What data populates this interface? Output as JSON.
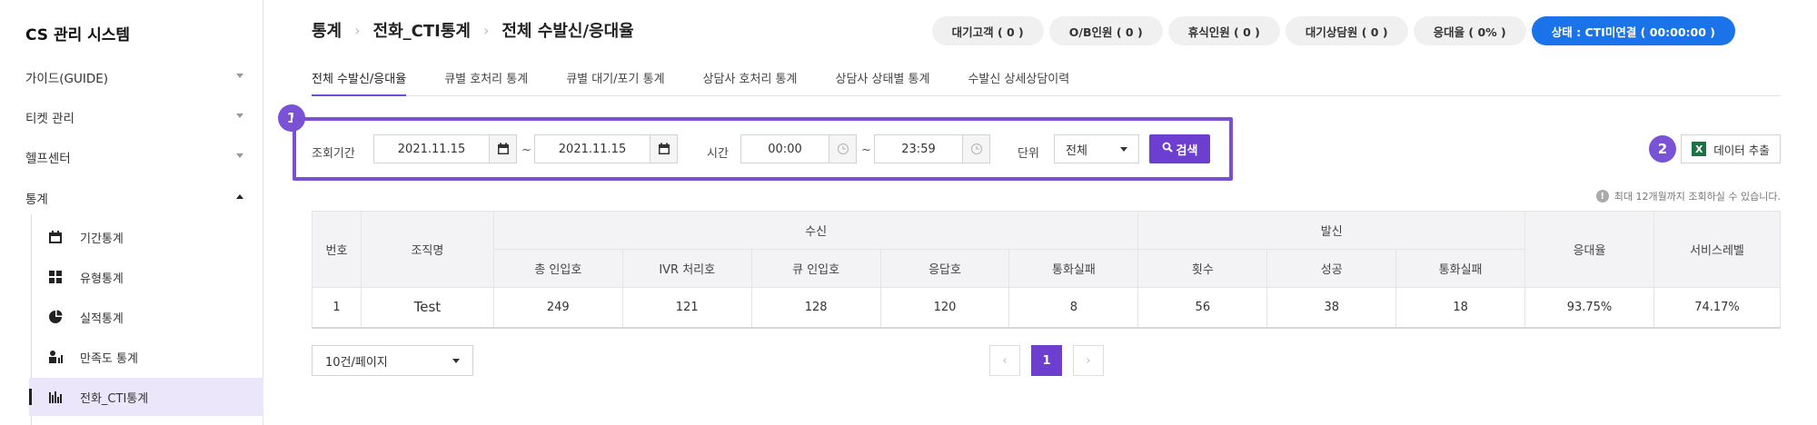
{
  "app": {
    "title": "CS 관리 시스템"
  },
  "sidebar": {
    "menus": [
      {
        "label": "가이드(GUIDE)",
        "expanded": false
      },
      {
        "label": "티켓 관리",
        "expanded": false
      },
      {
        "label": "헬프센터",
        "expanded": false
      },
      {
        "label": "통계",
        "expanded": true
      }
    ],
    "sub_items": [
      {
        "label": "기간통계",
        "icon": "calendar-icon"
      },
      {
        "label": "유형통계",
        "icon": "grid-icon"
      },
      {
        "label": "실적통계",
        "icon": "pie-chart-icon"
      },
      {
        "label": "만족도 통계",
        "icon": "satisfaction-icon"
      },
      {
        "label": "전화_CTI통계",
        "icon": "bar-chart-icon",
        "active": true
      }
    ]
  },
  "header": {
    "breadcrumb": [
      "통계",
      "전화_CTI통계",
      "전체 수발신/응대율"
    ],
    "status_pills": [
      "대기고객 ( 0 )",
      "O/B인원 ( 0 )",
      "휴식인원 ( 0 )",
      "대기상담원 ( 0 )",
      "응대율 ( 0% )"
    ],
    "status_main": "상태 : CTI미연결 ( 00:00:00 )"
  },
  "tabs": [
    "전체 수발신/응대율",
    "큐별 호처리 통계",
    "큐별 대기/포기 통계",
    "상담사 호처리 통계",
    "상담사 상태별 통계",
    "수발신 상세상담이력"
  ],
  "filter": {
    "badge": "1",
    "period_label": "조회기간",
    "date_from": "2021.11.15",
    "date_to": "2021.11.15",
    "tilde": "~",
    "time_label": "시간",
    "time_from": "00:00",
    "time_to": "23:59",
    "unit_label": "단위",
    "unit_value": "전체",
    "search_label": "검색"
  },
  "export": {
    "badge": "2",
    "label": "데이터 추출"
  },
  "notice": "최대 12개월까지 조회하실 수 있습니다.",
  "table": {
    "headers": {
      "no": "번호",
      "org": "조직명",
      "inbound": "수신",
      "outbound": "발신",
      "answer_rate": "응대율",
      "service_level": "서비스레벨",
      "inbound_cols": [
        "총 인입호",
        "IVR 처리호",
        "큐 인입호",
        "응답호",
        "통화실패"
      ],
      "outbound_cols": [
        "횟수",
        "성공",
        "통화실패"
      ]
    },
    "rows": [
      [
        "1",
        "Test",
        "249",
        "121",
        "128",
        "120",
        "8",
        "56",
        "38",
        "18",
        "93.75%",
        "74.17%"
      ]
    ]
  },
  "pagination": {
    "page_size": "10건/페이지",
    "prev": "‹",
    "current": "1",
    "next": "›"
  },
  "colors": {
    "accent": "#6c3fd1",
    "status_blue": "#1a73e8",
    "highlight": "#7b4fd2"
  }
}
